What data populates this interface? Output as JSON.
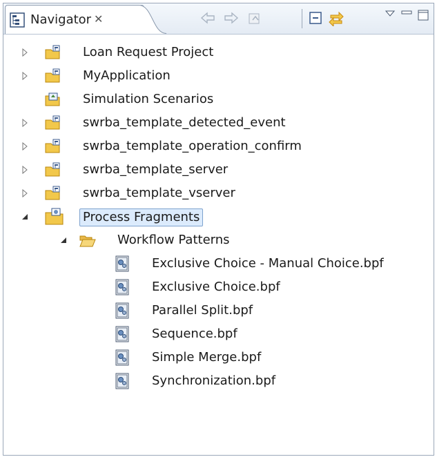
{
  "view": {
    "title": "Navigator",
    "close_glyph": "✕",
    "toolbar": [
      {
        "name": "back-icon"
      },
      {
        "name": "forward-icon"
      },
      {
        "name": "up-icon"
      },
      {
        "name": "collapse-all-icon"
      },
      {
        "name": "link-with-editor-icon"
      },
      {
        "name": "view-menu-icon"
      },
      {
        "name": "minimize-icon"
      },
      {
        "name": "maximize-icon"
      }
    ]
  },
  "tree": {
    "projects": [
      {
        "label": "Loan Request Project",
        "expanded": false,
        "icon": "project-folder-icon"
      },
      {
        "label": "MyApplication",
        "expanded": false,
        "icon": "project-folder-icon"
      },
      {
        "label": "Simulation Scenarios",
        "expanded": null,
        "icon": "simulation-folder-icon"
      },
      {
        "label": "swrba_template_detected_event",
        "expanded": false,
        "icon": "project-folder-icon"
      },
      {
        "label": "swrba_template_operation_confirm",
        "expanded": false,
        "icon": "project-folder-icon"
      },
      {
        "label": "swrba_template_server",
        "expanded": false,
        "icon": "project-folder-icon"
      },
      {
        "label": "swrba_template_vserver",
        "expanded": false,
        "icon": "project-folder-icon"
      },
      {
        "label": "Process Fragments",
        "expanded": true,
        "icon": "process-fragments-icon",
        "selected": true
      }
    ],
    "folder": {
      "label": "Workflow Patterns",
      "expanded": true,
      "icon": "folder-open-icon"
    },
    "files": [
      {
        "label": "Exclusive Choice - Manual Choice.bpf",
        "icon": "bpf-file-icon"
      },
      {
        "label": "Exclusive Choice.bpf",
        "icon": "bpf-file-icon"
      },
      {
        "label": "Parallel Split.bpf",
        "icon": "bpf-file-icon"
      },
      {
        "label": "Sequence.bpf",
        "icon": "bpf-file-icon"
      },
      {
        "label": "Simple Merge.bpf",
        "icon": "bpf-file-icon"
      },
      {
        "label": "Synchronization.bpf",
        "icon": "bpf-file-icon"
      }
    ]
  },
  "colors": {
    "selection_bg": "#dcebfc",
    "selection_border": "#7da2ce",
    "folder_yellow": "#f2c84b",
    "toolbar_accent": "#e8a317"
  }
}
